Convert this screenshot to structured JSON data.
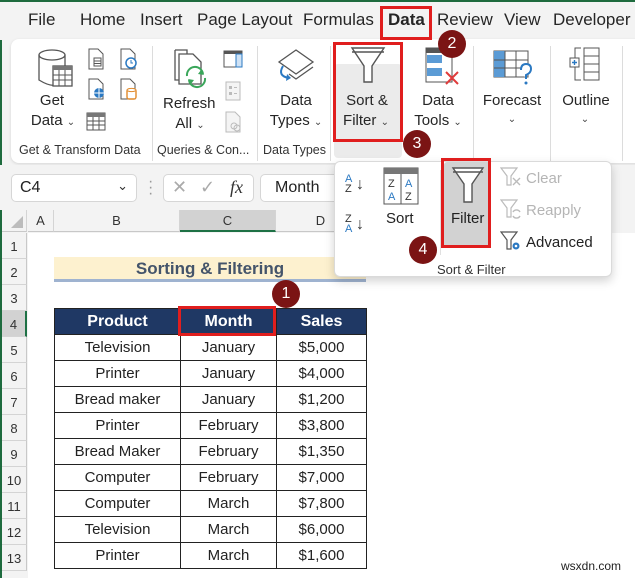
{
  "tabs": [
    "File",
    "Home",
    "Insert",
    "Page Layout",
    "Formulas",
    "Data",
    "Review",
    "View",
    "Developer"
  ],
  "active_tab": "Data",
  "ribbon": {
    "get_data": {
      "line1": "Get",
      "line2": "Data"
    },
    "refresh_all": {
      "line1": "Refresh",
      "line2": "All"
    },
    "data_types": {
      "line1": "Data",
      "line2": "Types"
    },
    "sort_filter": {
      "line1": "Sort &",
      "line2": "Filter"
    },
    "data_tools": {
      "line1": "Data",
      "line2": "Tools"
    },
    "forecast": {
      "line1": "Forecast"
    },
    "outline": {
      "line1": "Outline"
    },
    "groups": [
      "Get & Transform Data",
      "Queries & Con...",
      "Data Types"
    ]
  },
  "formula_bar": {
    "name_box": "C4",
    "fx": "fx",
    "formula": "Month"
  },
  "columns": [
    "A",
    "B",
    "C",
    "D"
  ],
  "selected_column": "C",
  "rows": [
    "1",
    "2",
    "3",
    "4",
    "5",
    "6",
    "7",
    "8",
    "9",
    "10",
    "11",
    "12",
    "13"
  ],
  "selected_row": "4",
  "sheet": {
    "title": "Sorting & Filtering",
    "headers": [
      "Product",
      "Month",
      "Sales"
    ],
    "data": [
      [
        "Television",
        "January",
        "$5,000"
      ],
      [
        "Printer",
        "January",
        "$4,000"
      ],
      [
        "Bread maker",
        "January",
        "$1,200"
      ],
      [
        "Printer",
        "February",
        "$3,800"
      ],
      [
        "Bread Maker",
        "February",
        "$1,350"
      ],
      [
        "Computer",
        "February",
        "$7,000"
      ],
      [
        "Computer",
        "March",
        "$7,800"
      ],
      [
        "Television",
        "March",
        "$6,000"
      ],
      [
        "Printer",
        "March",
        "$1,600"
      ]
    ]
  },
  "sort_filter_popup": {
    "sort_label": "Sort",
    "filter_label": "Filter",
    "clear_label": "Clear",
    "reapply_label": "Reapply",
    "advanced_label": "Advanced",
    "group_label": "Sort & Filter",
    "sort_az": {
      "top": "A",
      "bottom": "Z"
    },
    "sort_za": {
      "top": "Z",
      "bottom": "A"
    }
  },
  "badges": [
    "1",
    "2",
    "3",
    "4"
  ],
  "watermark": "wsxdn.com",
  "colors": {
    "accent_green": "#1e7145",
    "highlight_red": "#e01e1e",
    "badge": "#7b1414",
    "table_header": "#1f3864",
    "title_band": "#fdf1cf"
  }
}
